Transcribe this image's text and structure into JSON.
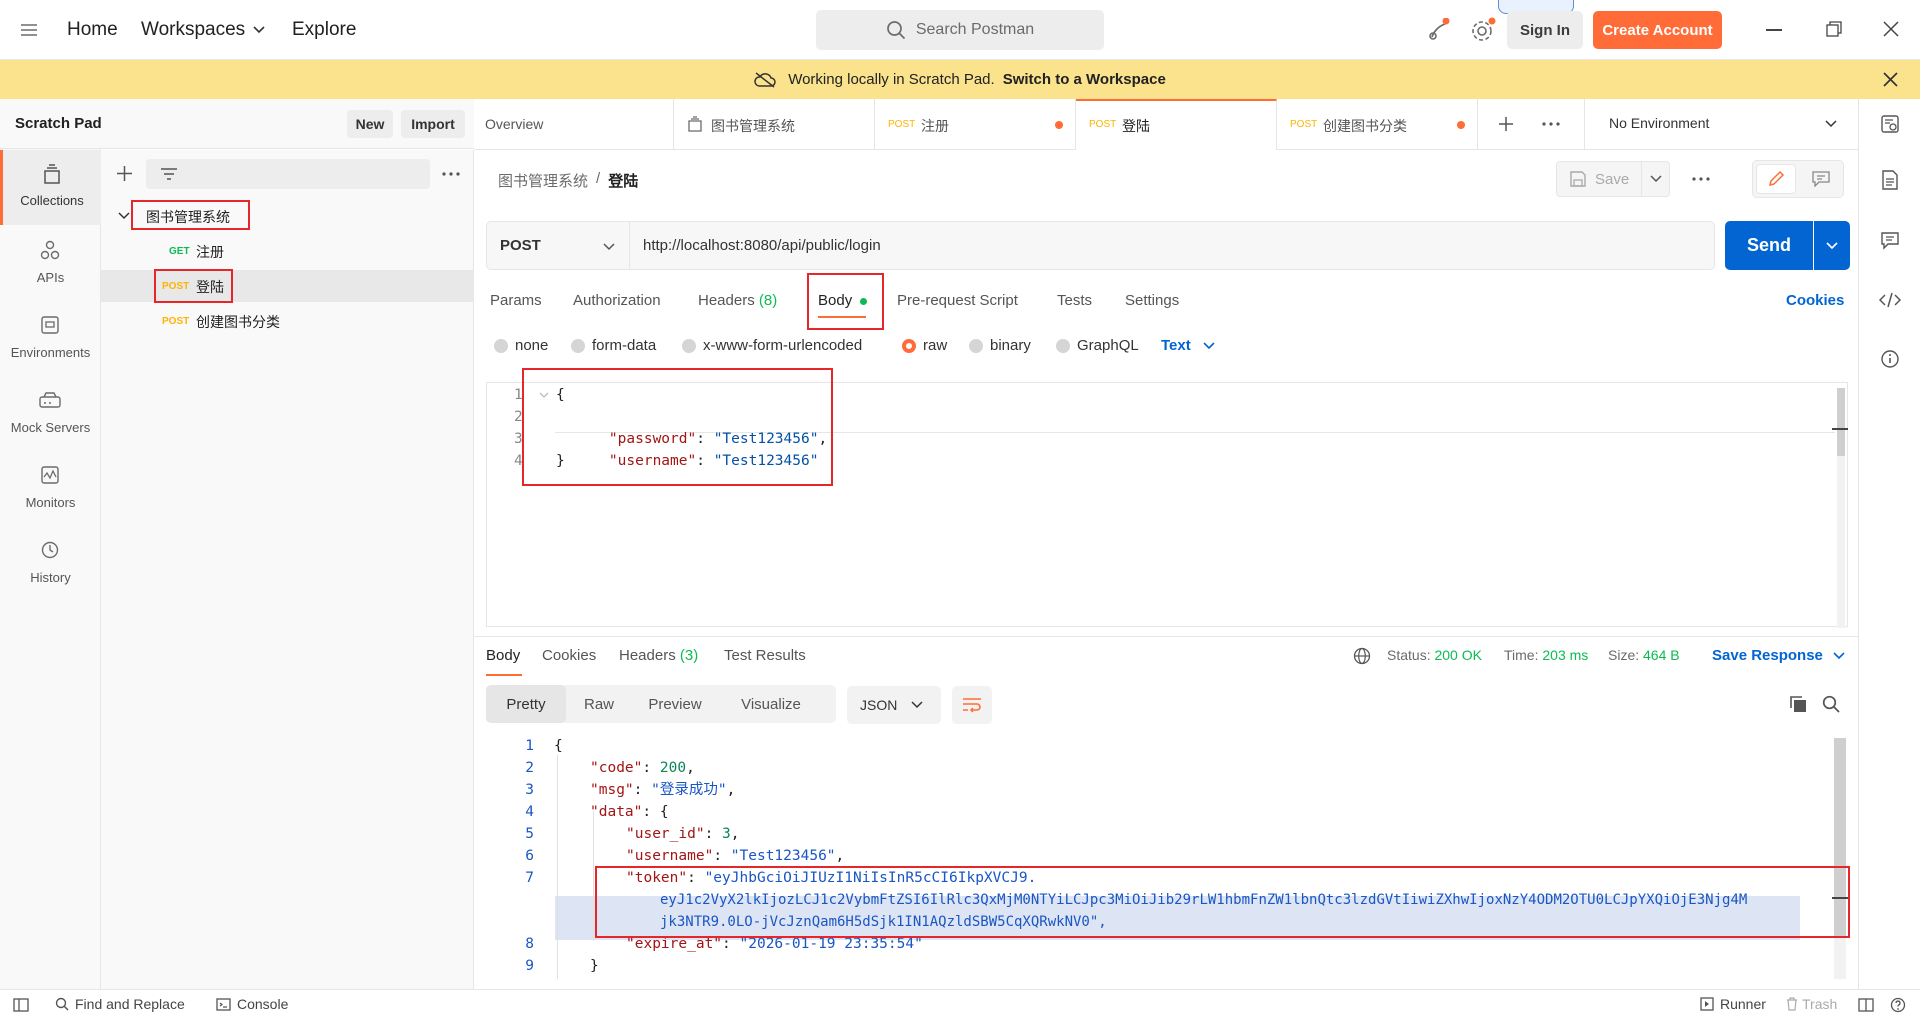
{
  "topbar": {
    "home": "Home",
    "workspaces": "Workspaces",
    "explore": "Explore",
    "search_placeholder": "Search Postman",
    "sign_in": "Sign In",
    "create_account": "Create Account"
  },
  "banner": {
    "text": "Working locally in Scratch Pad.",
    "link": "Switch to a Workspace"
  },
  "sidebar": {
    "title": "Scratch Pad",
    "new": "New",
    "import": "Import",
    "nav": [
      {
        "label": "Collections",
        "icon": "collections-icon"
      },
      {
        "label": "APIs",
        "icon": "apis-icon"
      },
      {
        "label": "Environments",
        "icon": "environments-icon"
      },
      {
        "label": "Mock Servers",
        "icon": "mock-servers-icon"
      },
      {
        "label": "Monitors",
        "icon": "monitors-icon"
      },
      {
        "label": "History",
        "icon": "history-icon"
      }
    ],
    "collection": {
      "name": "图书管理系统",
      "requests": [
        {
          "method": "GET",
          "name": "注册"
        },
        {
          "method": "POST",
          "name": "登陆"
        },
        {
          "method": "POST",
          "name": "创建图书分类"
        }
      ]
    }
  },
  "tabs": [
    {
      "method": "",
      "label": "Overview"
    },
    {
      "method": "",
      "label": "图书管理系统"
    },
    {
      "method": "POST",
      "label": "注册"
    },
    {
      "method": "POST",
      "label": "登陆"
    },
    {
      "method": "POST",
      "label": "创建图书分类"
    }
  ],
  "environment": "No Environment",
  "breadcrumb": {
    "parent": "图书管理系统",
    "sep": "/",
    "current": "登陆"
  },
  "save": "Save",
  "request": {
    "method": "POST",
    "url": "http://localhost:8080/api/public/login",
    "send": "Send"
  },
  "req_tabs": {
    "params": "Params",
    "authorization": "Authorization",
    "headers": "Headers",
    "headers_count": "(8)",
    "body": "Body",
    "prerequest": "Pre-request Script",
    "tests": "Tests",
    "settings": "Settings",
    "cookies": "Cookies"
  },
  "body_types": {
    "none": "none",
    "form_data": "form-data",
    "urlencoded": "x-www-form-urlencoded",
    "raw": "raw",
    "binary": "binary",
    "graphql": "GraphQL",
    "text": "Text"
  },
  "request_body": {
    "line_numbers": [
      "1",
      "2",
      "3",
      "4"
    ],
    "open": "{",
    "pw_key": "\"password\"",
    "pw_val": "\"Test123456\"",
    "user_key": "\"username\"",
    "user_val": "\"Test123456\"",
    "close": "}"
  },
  "response": {
    "tabs": {
      "body": "Body",
      "cookies": "Cookies",
      "headers": "Headers",
      "headers_count": "(3)",
      "tests": "Test Results"
    },
    "status_label": "Status:",
    "status": "200 OK",
    "time_label": "Time:",
    "time": "203 ms",
    "size_label": "Size:",
    "size": "464 B",
    "save_response": "Save Response",
    "views": {
      "pretty": "Pretty",
      "raw": "Raw",
      "preview": "Preview",
      "visualize": "Visualize"
    },
    "format": "JSON",
    "line_numbers": [
      "1",
      "2",
      "3",
      "4",
      "5",
      "6",
      "7",
      "8",
      "9"
    ],
    "code_key": "\"code\"",
    "code_val": "200",
    "msg_key": "\"msg\"",
    "msg_val": "\"登录成功\"",
    "data_key": "\"data\"",
    "user_id_key": "\"user_id\"",
    "user_id_val": "3",
    "username_key": "\"username\"",
    "username_val": "\"Test123456\"",
    "token_key": "\"token\"",
    "token_line1": "\"eyJhbGciOiJIUzI1NiIsInR5cCI6IkpXVCJ9.",
    "token_line2": "eyJ1c2VyX2lkIjozLCJ1c2VybmFtZSI6IlRlc3QxMjM0NTYiLCJpc3MiOiJib29rLW1hbmFnZW1lbnQtc3lzdGVtIiwiZXhwIjoxNzY4ODM2OTU0LCJpYXQiOjE3Njg4M",
    "token_line3": "jk3NTR9.0LO-jVcJznQam6H5dSjk1IN1AQzldSBW5CqXQRwkNV0\",",
    "expire_key": "\"expire_at\"",
    "expire_val": "\"2026-01-19 23:35:54\""
  },
  "footer": {
    "find_replace": "Find and Replace",
    "console": "Console",
    "runner": "Runner",
    "trash": "Trash"
  },
  "colors": {
    "accent": "#ff6c37",
    "send": "#0265d2",
    "banner": "#fbe38e",
    "get": "#0cbb52",
    "post": "#ffb400"
  }
}
